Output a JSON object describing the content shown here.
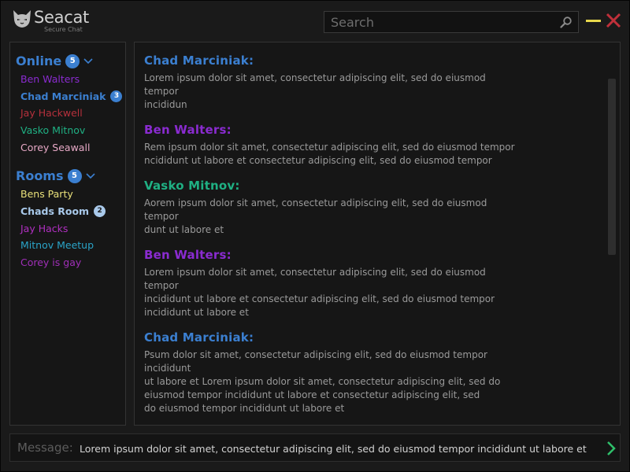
{
  "app": {
    "name": "Seacat",
    "tagline": "Secure Chat"
  },
  "search": {
    "placeholder": "Search"
  },
  "online": {
    "title": "Online",
    "count": "5",
    "users": [
      {
        "name": "Ben Walters",
        "color": "#8a2bd0"
      },
      {
        "name": "Chad Marciniak",
        "color": "#3b7fd0",
        "badge": "3"
      },
      {
        "name": "Jay Hackwell",
        "color": "#b6303c"
      },
      {
        "name": "Vasko Mitnov",
        "color": "#1fb083"
      },
      {
        "name": "Corey Seawall",
        "color": "#e7a9c6"
      }
    ]
  },
  "rooms": {
    "title": "Rooms",
    "count": "5",
    "items": [
      {
        "name": "Bens Party",
        "color": "#e9e07a"
      },
      {
        "name": "Chads Room",
        "color": "#a9c9ea",
        "badge": "2"
      },
      {
        "name": "Jay Hacks",
        "color": "#b02fc1"
      },
      {
        "name": "Mitnov Meetup",
        "color": "#2aa4c8"
      },
      {
        "name": "Corey is gay",
        "color": "#a02fb8"
      }
    ]
  },
  "messages": [
    {
      "author": "Chad Marciniak:",
      "color": "#3b7fd0",
      "text": "Lorem ipsum dolor sit amet, consectetur adipiscing elit, sed do eiusmod tempor\nincididun"
    },
    {
      "author": "Ben Walters:",
      "color": "#8a2bd0",
      "text": "Rem ipsum dolor sit amet, consectetur adipiscing elit, sed do eiusmod tempor\nncididunt ut labore et  consectetur adipiscing elit, sed do eiusmod tempor"
    },
    {
      "author": "Vasko Mitnov:",
      "color": "#1fb083",
      "text": "Aorem ipsum dolor sit amet, consectetur adipiscing elit, sed do eiusmod tempor\ndunt ut labore et"
    },
    {
      "author": "Ben Walters:",
      "color": "#8a2bd0",
      "text": "Lorem ipsum dolor sit amet, consectetur adipiscing elit, sed do eiusmod tempor\nincididunt ut labore et  consectetur adipiscing elit, sed do eiusmod tempor\nincididunt ut labore et"
    },
    {
      "author": "Chad Marciniak:",
      "color": "#3b7fd0",
      "text": "Psum dolor sit amet, consectetur adipiscing elit, sed do eiusmod tempor incididunt\nut labore et Lorem ipsum dolor sit amet, consectetur adipiscing elit, sed do\neiusmod tempor incididunt ut labore et  consectetur adipiscing elit, sed\ndo eiusmod tempor incididunt ut labore et"
    }
  ],
  "composer": {
    "label": "Message:",
    "value": "Lorem ipsum dolor sit amet, consectetur adipiscing elit, sed do eiusmod tempor incididunt ut labore et"
  },
  "colors": {
    "accent": "#3b7fd0",
    "minimize": "#e8d84c",
    "close": "#c0303a",
    "send": "#2fbf6a"
  }
}
